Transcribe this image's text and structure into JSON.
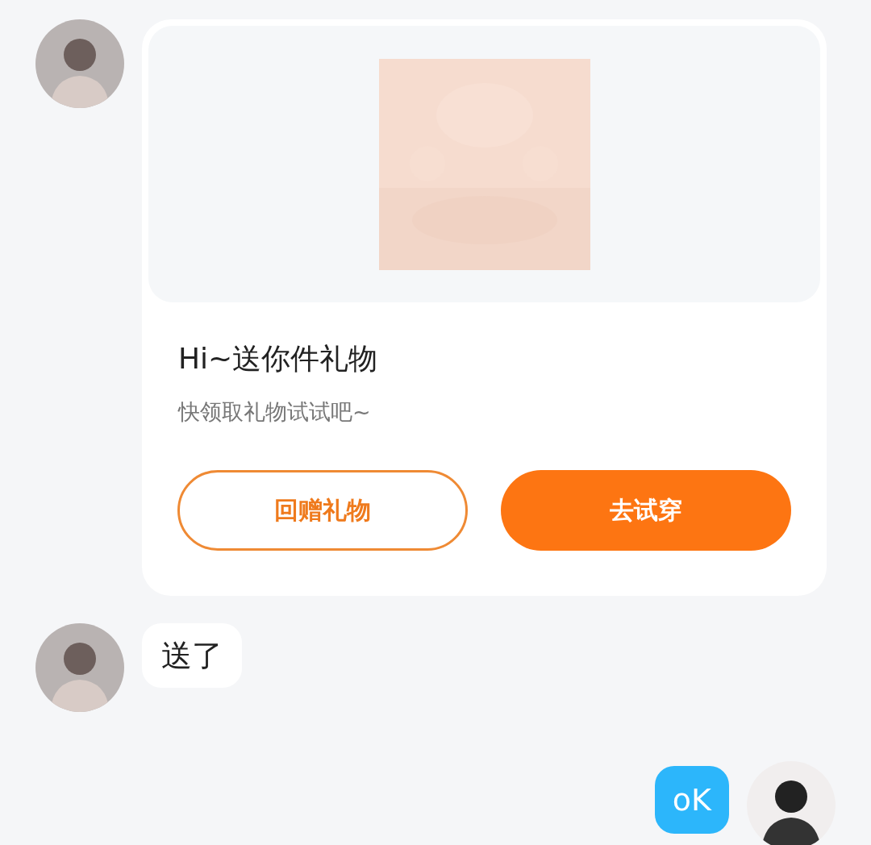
{
  "messages": [
    {
      "kind": "gift_card",
      "outgoing": false,
      "title": "Hi~送你件礼物",
      "subtitle": "快领取礼物试试吧~",
      "buttons": [
        {
          "label": "回赠礼物",
          "kind": "outline"
        },
        {
          "label": "去试穿",
          "kind": "filled"
        }
      ]
    },
    {
      "kind": "text",
      "outgoing": false,
      "text": "送了"
    },
    {
      "kind": "text",
      "outgoing": true,
      "text": "oK"
    }
  ]
}
